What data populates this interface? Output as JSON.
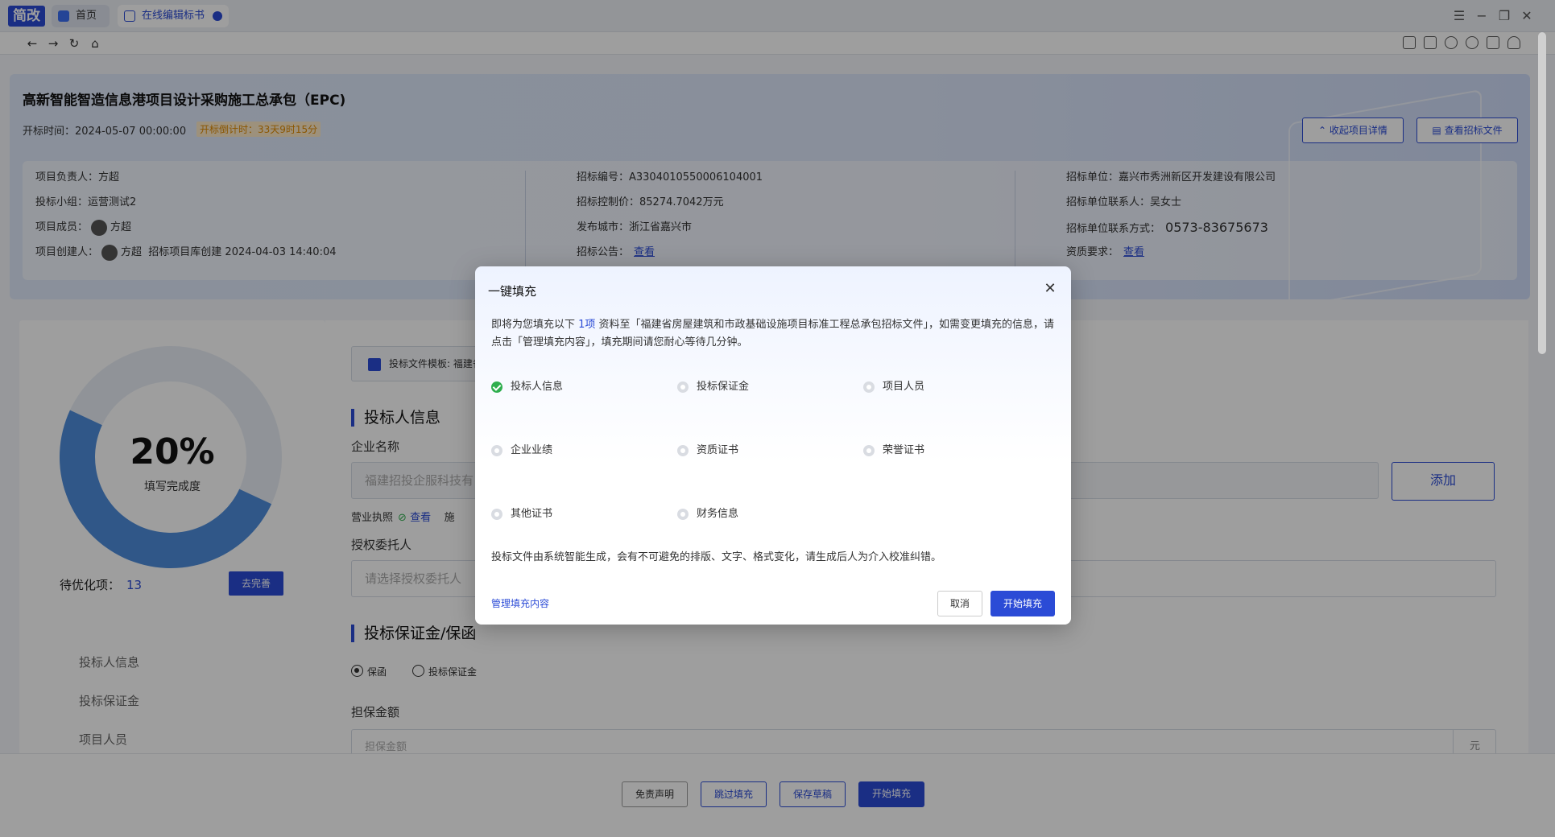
{
  "app": {
    "logo": "简改"
  },
  "tabs": [
    {
      "label": "首页"
    },
    {
      "label": "在线编辑标书"
    }
  ],
  "project": {
    "title": "高新智能智造信息港项目设计采购施工总承包（EPC)",
    "open_time_label": "开标时间：",
    "open_time": "2024-05-07 00:00:00",
    "countdown": "开标倒计时：33天9时15分",
    "collapse_btn": "收起项目详情",
    "view_doc_btn": "查看招标文件",
    "col1": {
      "leader": "项目负责人：方超",
      "group": "投标小组：运营测试2",
      "members_label": "项目成员：",
      "member_name": "方超",
      "creator_label": "项目创建人：",
      "creator_name": "方超",
      "creator_info": "招标项目库创建  2024-04-03 14:40:04"
    },
    "col2": {
      "code": "招标编号：A3304010550006104001",
      "price": "招标控制价：85274.7042万元",
      "city": "发布城市：浙江省嘉兴市",
      "notice_label": "招标公告：",
      "notice_link": "查看"
    },
    "col3": {
      "unit": "招标单位：嘉兴市秀洲新区开发建设有限公司",
      "contact": "招标单位联系人：吴女士",
      "phone_label": "招标单位联系方式：",
      "phone": "0573-83675673",
      "qual_label": "资质要求：",
      "qual_link": "查看"
    }
  },
  "progress": {
    "percent": "20%",
    "percent_value": 20,
    "label": "填写完成度",
    "pending_label": "待优化项：",
    "pending_count": "13",
    "go_btn": "去完善"
  },
  "side_nav": [
    {
      "label": "投标人信息"
    },
    {
      "label": "投标保证金"
    },
    {
      "label": "项目人员"
    }
  ],
  "main": {
    "template": "投标文件模板: 福建省",
    "sec1": "投标人信息",
    "company_label": "企业名称",
    "company_placeholder": "福建招投企服科技有",
    "add_btn": "添加",
    "license_label": "营业执照",
    "license_link": "查看",
    "license_extra": "施",
    "auth_label": "授权委托人",
    "auth_placeholder": "请选择授权委托人",
    "sec2": "投标保证金/保函",
    "radio1": "保函",
    "radio2": "投标保证金",
    "amount_label": "担保金额",
    "amount_placeholder": "担保金额",
    "unit": "元"
  },
  "bottom": {
    "disclaimer": "免责声明",
    "skip": "跳过填充",
    "save": "保存草稿",
    "start": "开始填充"
  },
  "modal": {
    "title": "一键填充",
    "desc_pre": "即将为您填充以下 ",
    "desc_count": "1项",
    "desc_post": " 资料至「福建省房屋建筑和市政基础设施项目标准工程总承包招标文件」，如需变更填充的信息，请点击「管理填充内容」，填充期间请您耐心等待几分钟。",
    "options": [
      {
        "label": "投标人信息",
        "checked": true
      },
      {
        "label": "投标保证金",
        "checked": false
      },
      {
        "label": "项目人员",
        "checked": false
      },
      {
        "label": "企业业绩",
        "checked": false
      },
      {
        "label": "资质证书",
        "checked": false
      },
      {
        "label": "荣誉证书",
        "checked": false
      },
      {
        "label": "其他证书",
        "checked": false
      },
      {
        "label": "财务信息",
        "checked": false
      }
    ],
    "note": "投标文件由系统智能生成，会有不可避免的排版、文字、格式变化，请生成后人为介入校准纠错。",
    "manage_link": "管理填充内容",
    "cancel": "取消",
    "start": "开始填充"
  },
  "colors": {
    "accent": "#2b4bd6",
    "success": "#2fae4e",
    "warning": "#e08a00"
  }
}
